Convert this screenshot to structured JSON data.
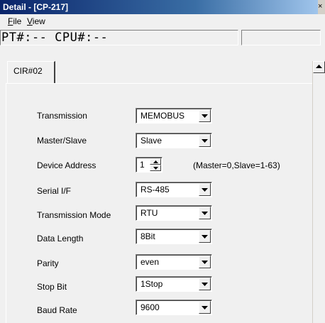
{
  "window": {
    "title": "Detail - [CP-217]",
    "close_glyph": "×"
  },
  "menu": {
    "items": [
      {
        "accel": "F",
        "rest": "ile"
      },
      {
        "accel": "V",
        "rest": "iew"
      }
    ]
  },
  "status": {
    "text": "PT#:-- CPU#:--"
  },
  "tabs": [
    {
      "label": "CIR#02"
    }
  ],
  "form": {
    "transmission": {
      "label": "Transmission",
      "value": "MEMOBUS"
    },
    "master_slave": {
      "label": "Master/Slave",
      "value": "Slave"
    },
    "device_address": {
      "label": "Device Address",
      "value": "1",
      "hint": "(Master=0,Slave=1-63)"
    },
    "serial_if": {
      "label": "Serial I/F",
      "value": "RS-485"
    },
    "transmission_mode": {
      "label": "Transmission Mode",
      "value": "RTU"
    },
    "data_length": {
      "label": "Data Length",
      "value": "8Bit"
    },
    "parity": {
      "label": "Parity",
      "value": "even"
    },
    "stop_bit": {
      "label": "Stop Bit",
      "value": "1Stop"
    },
    "baud_rate": {
      "label": "Baud Rate",
      "value": "9600"
    }
  },
  "icons": {
    "combo_drop": "chevron-down-icon",
    "spin_up": "spin-up-icon",
    "spin_down": "spin-down-icon",
    "scroll_up": "scroll-up-icon"
  }
}
